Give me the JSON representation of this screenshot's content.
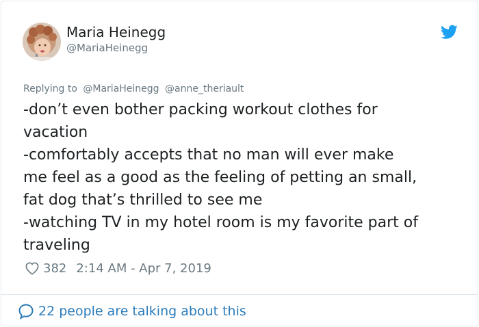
{
  "author": {
    "name": "Maria Heinegg",
    "handle": "@MariaHeinegg"
  },
  "reply": {
    "prefix": "Replying to",
    "mentions": [
      "@MariaHeinegg",
      "@anne_theriault"
    ]
  },
  "tweet": {
    "lines": [
      "-don’t even bother packing workout clothes for",
      "vacation",
      "-comfortably accepts that no man will ever make",
      "me feel as a good as the feeling of petting an small,",
      "fat dog that’s thrilled to see me",
      "-watching TV in my hotel room is my favorite part of",
      "traveling"
    ]
  },
  "meta": {
    "likes": "382",
    "timestamp": "2:14 AM - Apr 7, 2019"
  },
  "footer": {
    "talking": "22 people are talking about this"
  },
  "icons": {
    "brand": "twitter-bird-icon",
    "like": "heart-icon",
    "conversation": "speech-bubble-icon"
  },
  "colors": {
    "brand_blue": "#1da1f2",
    "link_blue": "#2b7bb9",
    "secondary_text": "#697882",
    "primary_text": "#1c2022",
    "border": "#e1e8ed"
  }
}
